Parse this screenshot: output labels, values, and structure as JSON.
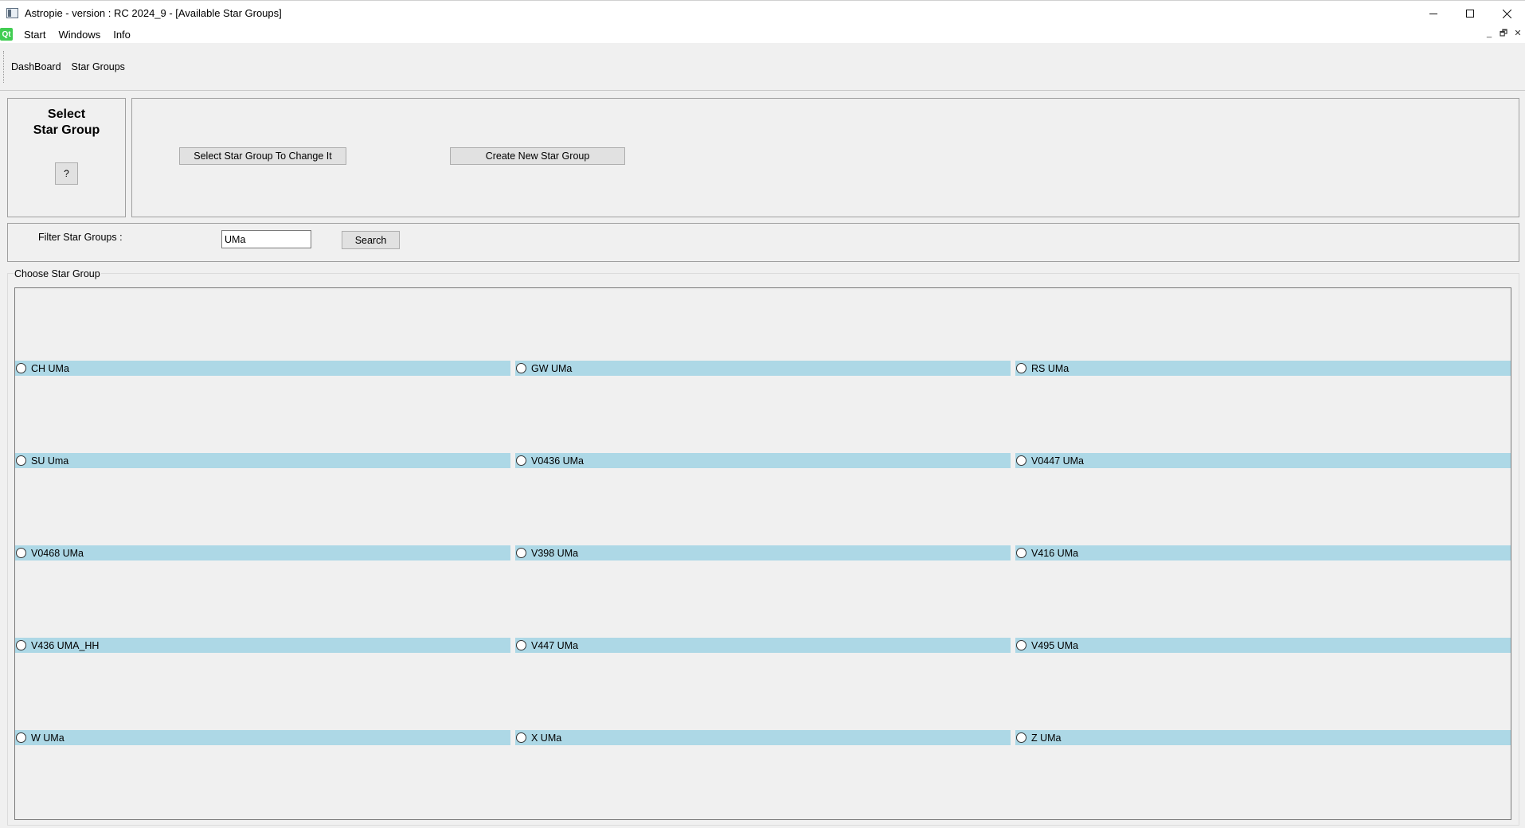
{
  "window": {
    "title": "Astropie - version : RC 2024_9 - [Available Star Groups]"
  },
  "menu": {
    "logo": "Qt",
    "items": [
      "Start",
      "Windows",
      "Info"
    ]
  },
  "tabs": [
    "DashBoard",
    "Star Groups"
  ],
  "select_panel": {
    "title_line1": "Select",
    "title_line2": "Star Group",
    "help_label": "?"
  },
  "actions": {
    "change_label": "Select Star Group To Change It",
    "create_label": "Create New Star Group"
  },
  "filter": {
    "label": "Filter Star Groups :",
    "value": "UMa",
    "search_label": "Search"
  },
  "groups": {
    "title": "Choose Star Group",
    "items": [
      "CH UMa",
      "GW UMa",
      "RS UMa",
      "SU Uma",
      "V0436 UMa",
      "V0447 UMa",
      "V0468 UMa",
      "V398 UMa",
      "V416 UMa",
      "V436 UMA_HH",
      "V447 UMa",
      "V495 UMa",
      "W UMa",
      "X UMa",
      "Z UMa"
    ]
  },
  "colors": {
    "row_highlight": "#add8e6",
    "qt_green": "#41cd52",
    "background": "#f0f0f0"
  }
}
